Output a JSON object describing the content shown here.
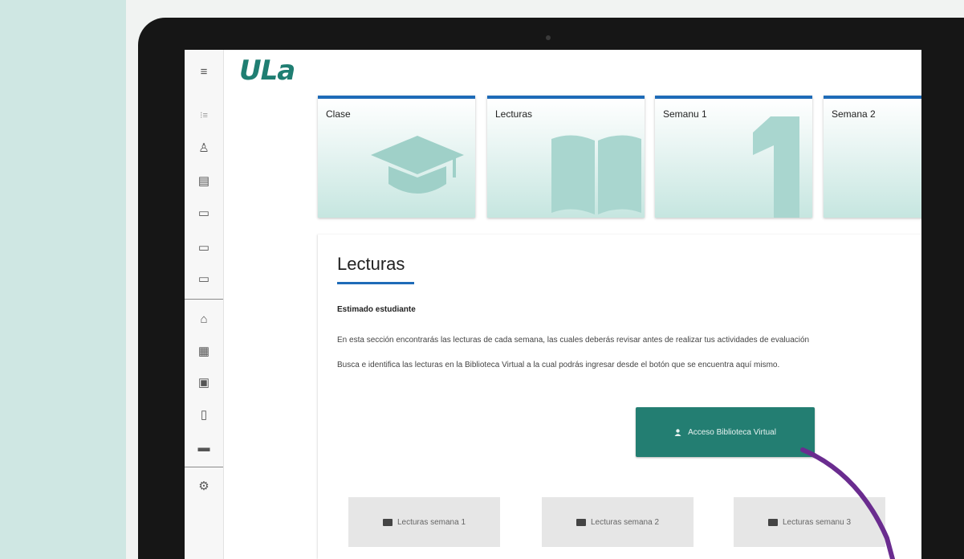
{
  "app": {
    "logo_text": "ULa"
  },
  "sidebar": {
    "items": [
      {
        "icon": "hamburger-menu-icon",
        "glyph": "≡"
      },
      {
        "icon": "list-icon",
        "glyph": "⁝≡"
      },
      {
        "icon": "user-icon",
        "glyph": "♙"
      },
      {
        "icon": "notes-icon",
        "glyph": "▤"
      },
      {
        "icon": "folder-icon",
        "glyph": "▭"
      },
      {
        "icon": "folder-icon",
        "glyph": "▭"
      },
      {
        "icon": "folder-icon",
        "glyph": "▭"
      },
      {
        "icon": "home-icon",
        "glyph": "⌂"
      },
      {
        "icon": "grid-icon",
        "glyph": "▦"
      },
      {
        "icon": "calendar-icon",
        "glyph": "▣"
      },
      {
        "icon": "document-icon",
        "glyph": "▯"
      },
      {
        "icon": "open-folder-icon",
        "glyph": "▬"
      },
      {
        "icon": "gear-icon",
        "glyph": "⚙"
      }
    ]
  },
  "cards": [
    {
      "label": "Clase",
      "icon": "graduation-cap-icon"
    },
    {
      "label": "Lecturas",
      "icon": "open-book-icon"
    },
    {
      "label": "Semanu 1",
      "icon": "number-one-icon"
    },
    {
      "label": "Semana 2",
      "icon": "number-two-icon"
    }
  ],
  "section": {
    "title": "Lecturas",
    "greeting": "Estimado estudiante",
    "paragraphs": [
      "En esta sección encontrarás las lecturas de cada semana, las cuales deberás revisar antes de realizar tus actividades de evaluación",
      "Busca e identifica las lecturas en la Biblioteca Virtual a la cual podrás ingresar desde el botón que se encuentra aquí mismo."
    ],
    "access_button": "Acceso Biblioteca Virtual",
    "week_buttons": [
      "Lecturas semana 1",
      "Lecturas semana 2",
      "Lecturas semanu 3"
    ]
  },
  "colors": {
    "accent_teal": "#237e72",
    "card_border_blue": "#1e6bb8",
    "annotation_arrow": "#6a2c8f"
  }
}
